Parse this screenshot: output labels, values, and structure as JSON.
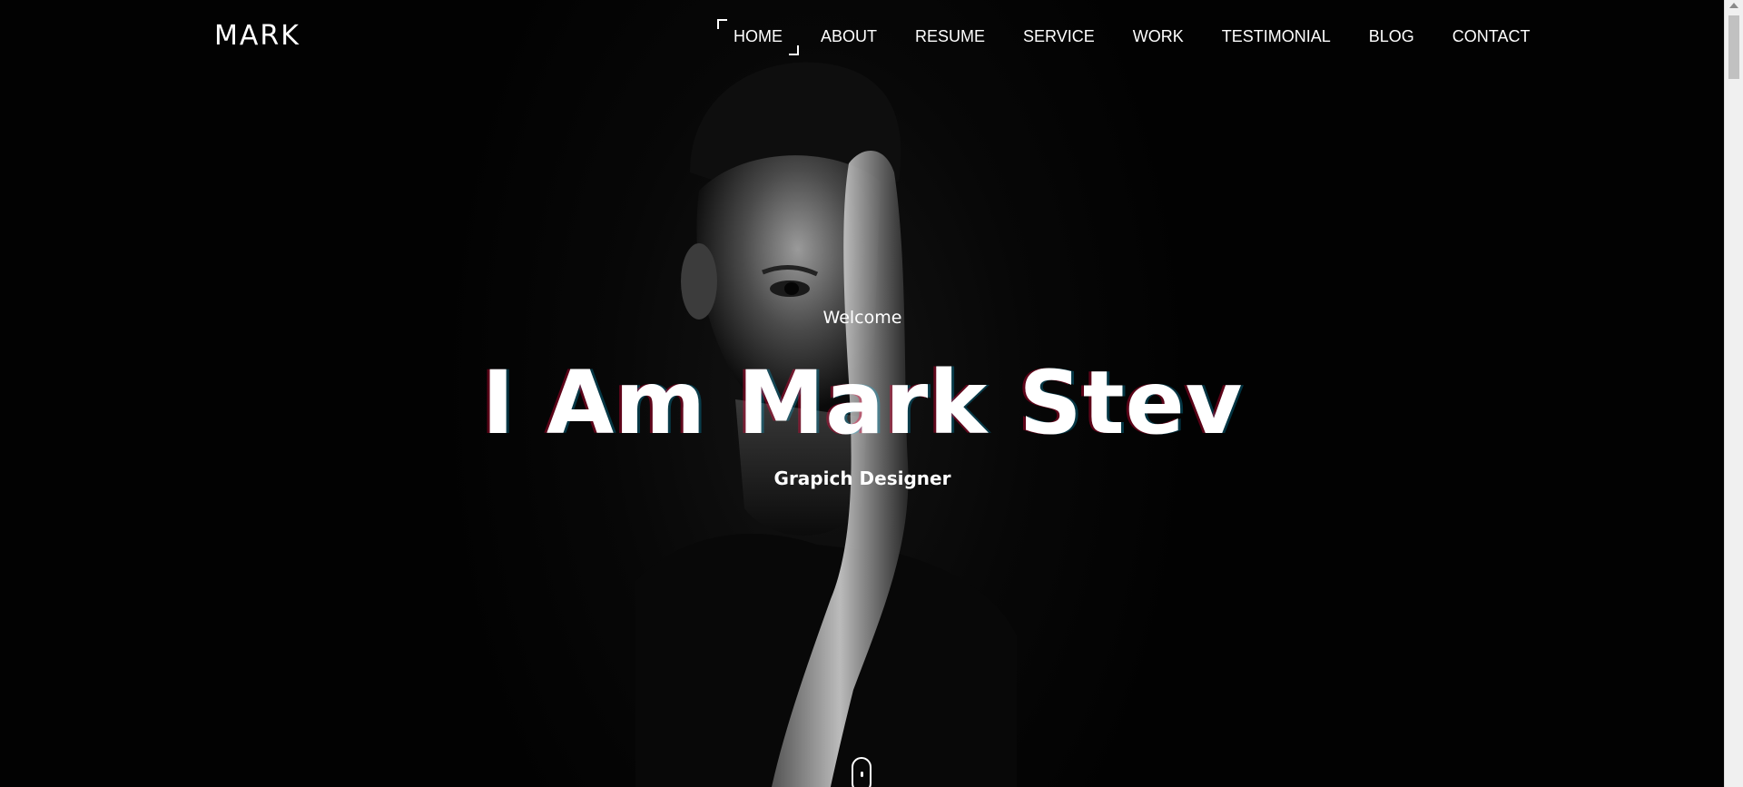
{
  "brand": {
    "logo_text": "MARK"
  },
  "nav": {
    "items": [
      {
        "label": "HOME",
        "active": true
      },
      {
        "label": "ABOUT",
        "active": false
      },
      {
        "label": "RESUME",
        "active": false
      },
      {
        "label": "SERVICE",
        "active": false
      },
      {
        "label": "WORK",
        "active": false
      },
      {
        "label": "TESTIMONIAL",
        "active": false
      },
      {
        "label": "BLOG",
        "active": false
      },
      {
        "label": "CONTACT",
        "active": false
      }
    ]
  },
  "hero": {
    "welcome": "Welcome",
    "headline": "I Am Mark Stev",
    "subtitle": "Grapich Designer",
    "scroll_icon": "mouse-scroll-icon"
  },
  "colors": {
    "background": "#030303",
    "text": "#ffffff",
    "scrollbar_track": "#f0f0f0",
    "scrollbar_thumb": "#c1c1c1"
  }
}
